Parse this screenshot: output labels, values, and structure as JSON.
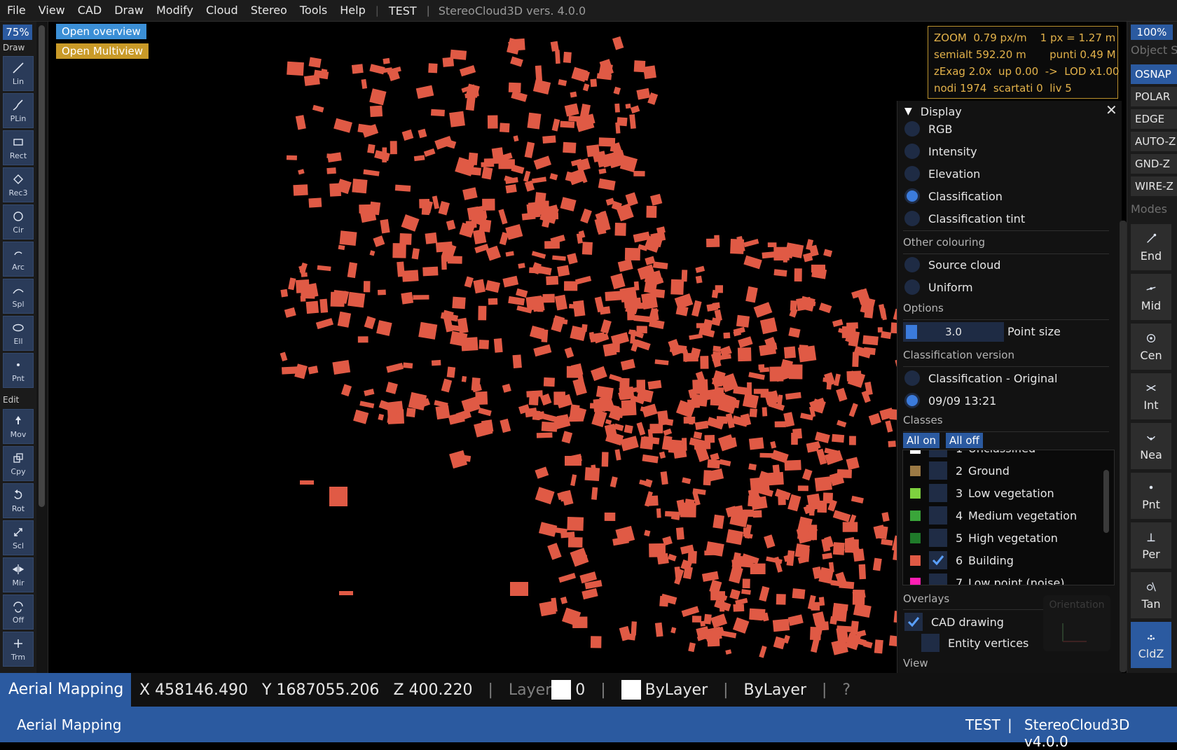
{
  "menubar": {
    "items": [
      "File",
      "View",
      "CAD",
      "Draw",
      "Modify",
      "Cloud",
      "Stereo",
      "Tools",
      "Help"
    ],
    "project": "TEST",
    "separator": "|",
    "app_version": "StereoCloud3D vers. 4.0.0"
  },
  "left_toolbar": {
    "zoom": "75%",
    "draw_label": "Draw",
    "edit_label": "Edit",
    "draw_tools": [
      {
        "label": "Lin",
        "icon": "line-icon"
      },
      {
        "label": "PLin",
        "icon": "polyline-icon"
      },
      {
        "label": "Rect",
        "icon": "rectangle-icon"
      },
      {
        "label": "Rec3",
        "icon": "rectangle-3pt-icon"
      },
      {
        "label": "Cir",
        "icon": "circle-icon"
      },
      {
        "label": "Arc",
        "icon": "arc-icon"
      },
      {
        "label": "Spl",
        "icon": "spline-icon"
      },
      {
        "label": "Ell",
        "icon": "ellipse-icon"
      },
      {
        "label": "Pnt",
        "icon": "point-icon"
      }
    ],
    "edit_tools": [
      {
        "label": "Mov",
        "icon": "move-icon"
      },
      {
        "label": "Cpy",
        "icon": "copy-icon"
      },
      {
        "label": "Rot",
        "icon": "rotate-icon"
      },
      {
        "label": "Scl",
        "icon": "scale-icon"
      },
      {
        "label": "Mir",
        "icon": "mirror-icon"
      },
      {
        "label": "Off",
        "icon": "offset-icon"
      },
      {
        "label": "Trm",
        "icon": "trim-icon"
      }
    ]
  },
  "viewport": {
    "open_overview": "Open overview",
    "open_multiview": "Open Multiview",
    "overview_color": "#3b8fd6",
    "multiview_color": "#c99a28",
    "building_color": "#e05a45"
  },
  "info": {
    "line1": "ZOOM  0.79 px/m    1 px = 1.27 m",
    "line2": "semialt 592.20 m       punti 0.49 M",
    "line3": "zExag 2.0x  up 0.00  ->  LOD x1.00",
    "line4": "nodi 1974  scartati 0  liv 5"
  },
  "right_toolbar": {
    "zoom": "100%",
    "object_snap_label": "Object Snap",
    "snap_buttons": [
      {
        "label": "OSNAP",
        "active": true
      },
      {
        "label": "POLAR",
        "active": false
      },
      {
        "label": "EDGE",
        "active": false
      },
      {
        "label": "AUTO-Z",
        "active": false
      },
      {
        "label": "GND-Z",
        "active": false
      },
      {
        "label": "WIRE-Z",
        "active": false
      }
    ],
    "modes_label": "Modes",
    "osnaps": [
      {
        "label": "End",
        "icon": "endpoint-icon"
      },
      {
        "label": "Mid",
        "icon": "midpoint-icon"
      },
      {
        "label": "Cen",
        "icon": "center-icon"
      },
      {
        "label": "Int",
        "icon": "intersection-icon"
      },
      {
        "label": "Nea",
        "icon": "nearest-icon"
      },
      {
        "label": "Pnt",
        "icon": "node-icon"
      },
      {
        "label": "Per",
        "icon": "perpendicular-icon"
      },
      {
        "label": "Tan",
        "icon": "tangent-icon"
      },
      {
        "label": "CldZ",
        "icon": "cloud-z-icon"
      }
    ]
  },
  "panel": {
    "title": "Display",
    "display_modes": [
      {
        "label": "RGB",
        "selected": false
      },
      {
        "label": "Intensity",
        "selected": false
      },
      {
        "label": "Elevation",
        "selected": false
      },
      {
        "label": "Classification",
        "selected": true
      },
      {
        "label": "Classification tint",
        "selected": false
      }
    ],
    "other_colouring_label": "Other colouring",
    "other_colouring": [
      {
        "label": "Source cloud",
        "selected": false
      },
      {
        "label": "Uniform",
        "selected": false
      }
    ],
    "options_label": "Options",
    "point_size_value": "3.0",
    "point_size_label": "Point size",
    "point_size_fraction": 0.12,
    "class_version_label": "Classification version",
    "class_versions": [
      {
        "label": "Classification - Original",
        "selected": false
      },
      {
        "label": "09/09 13:21",
        "selected": true
      }
    ],
    "classes_label": "Classes",
    "all_on": "All on",
    "all_off": "All off",
    "classes": [
      {
        "num": "1",
        "name": "Unclassified",
        "color": "#ffffff",
        "checked": false
      },
      {
        "num": "2",
        "name": "Ground",
        "color": "#9c7a45",
        "checked": false
      },
      {
        "num": "3",
        "name": "Low vegetation",
        "color": "#7ed13f",
        "checked": false
      },
      {
        "num": "4",
        "name": "Medium vegetation",
        "color": "#3aa53a",
        "checked": false
      },
      {
        "num": "5",
        "name": "High vegetation",
        "color": "#1f7a2a",
        "checked": false
      },
      {
        "num": "6",
        "name": "Building",
        "color": "#e05a45",
        "checked": true
      },
      {
        "num": "7",
        "name": "Low point (noise)",
        "color": "#ff1fb4",
        "checked": false
      }
    ],
    "overlays_label": "Overlays",
    "overlays": [
      {
        "label": "CAD drawing",
        "checked": true
      },
      {
        "label": "Entity vertices",
        "checked": false
      }
    ],
    "view_label": "View",
    "orientation_label": "Orientation"
  },
  "coordbar": {
    "mode": "Aerial Mapping",
    "x": "X 458146.490",
    "y": "Y 1687055.206",
    "z": "Z 400.220",
    "sep": "|",
    "layer_label": "Layer",
    "layer_value": "0",
    "color_value": "ByLayer",
    "linetype_value": "ByLayer",
    "help": "?"
  },
  "statusbar": {
    "left": "Aerial Mapping",
    "project": "TEST",
    "sep": "|",
    "version": "StereoCloud3D v4.0.0"
  }
}
